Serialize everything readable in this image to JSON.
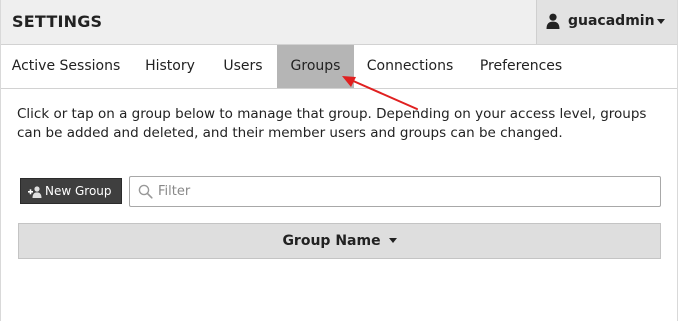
{
  "header": {
    "title": "SETTINGS",
    "user": {
      "name": "guacadmin",
      "icon": "user-icon"
    }
  },
  "tabs": [
    {
      "label": "Active Sessions",
      "active": false
    },
    {
      "label": "History",
      "active": false
    },
    {
      "label": "Users",
      "active": false
    },
    {
      "label": "Groups",
      "active": true
    },
    {
      "label": "Connections",
      "active": false
    },
    {
      "label": "Preferences",
      "active": false
    }
  ],
  "main": {
    "description": "Click or tap on a group below to manage that group. Depending on your access level, groups can be added and deleted, and their member users and groups can be changed.",
    "new_group_label": "New Group",
    "filter": {
      "placeholder": "Filter",
      "value": ""
    },
    "table": {
      "columns": [
        "Group Name"
      ]
    }
  },
  "colors": {
    "header_bg": "#efefef",
    "active_tab_bg": "#b5b5b5",
    "button_bg": "#3f3f3f",
    "annotation_arrow": "#e02020"
  }
}
